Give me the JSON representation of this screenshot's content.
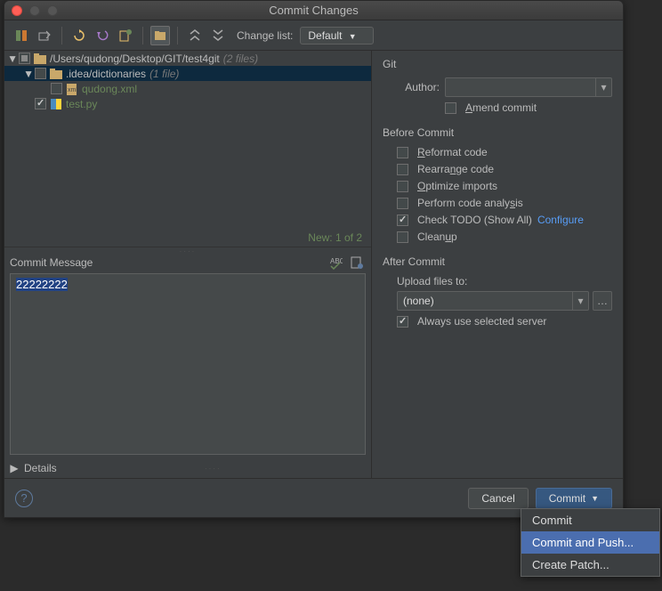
{
  "title": "Commit Changes",
  "toolbar": {
    "changelist_label": "Change list:",
    "changelist_value": "Default"
  },
  "tree": {
    "root": {
      "path": "/Users/qudong/Desktop/GIT/test4git",
      "count": "(2 files)"
    },
    "dir": {
      "path": ".idea/dictionaries",
      "count": "(1 file)"
    },
    "file1": "qudong.xml",
    "file2": "test.py",
    "new_status": "New: 1 of 2"
  },
  "commit_message": {
    "label": "Commit Message",
    "text": "22222222"
  },
  "details": {
    "label": "Details"
  },
  "git": {
    "section": "Git",
    "author_label": "Author:",
    "amend": "Amend commit"
  },
  "before": {
    "section": "Before Commit",
    "reformat": "Reformat code",
    "rearrange": "Rearrange code",
    "optimize": "Optimize imports",
    "analysis": "Perform code analysis",
    "todo": "Check TODO (Show All)",
    "todo_configure": "Configure",
    "cleanup": "Cleanup"
  },
  "after": {
    "section": "After Commit",
    "upload_label": "Upload files to:",
    "upload_value": "(none)",
    "always": "Always use selected server"
  },
  "footer": {
    "cancel": "Cancel",
    "commit": "Commit"
  },
  "dropdown": {
    "commit": "Commit",
    "commit_push": "Commit and Push...",
    "create_patch": "Create Patch..."
  }
}
